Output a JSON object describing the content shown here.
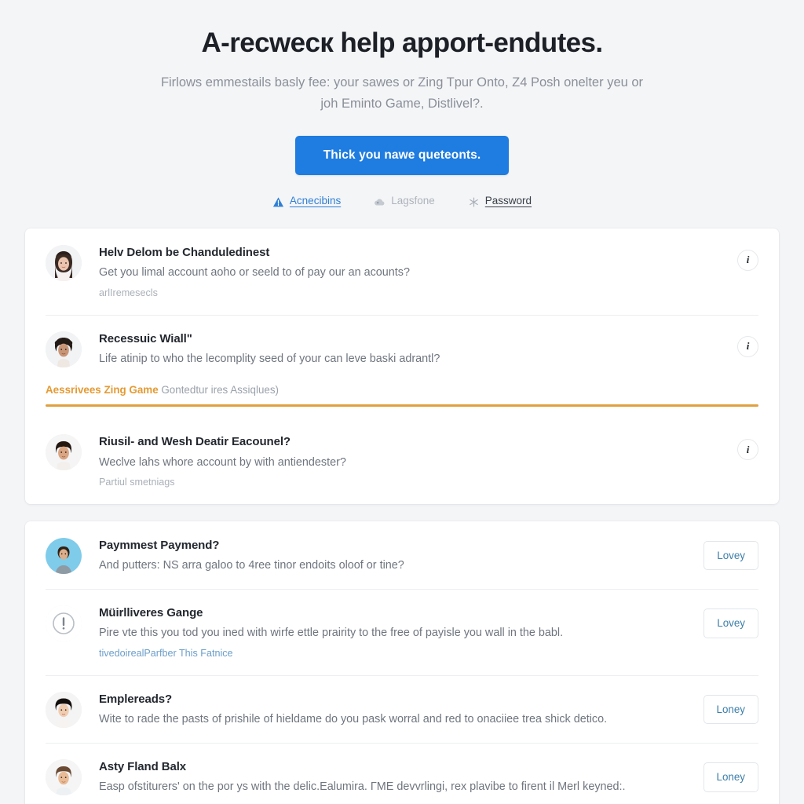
{
  "hero": {
    "title": "A-recwecк help apport-endutes.",
    "subtitle": "Firlows emmestails basly fee: your sawes or Zing Tpur Onto, Z4 Posh onelter yeu or joh Eminto Game, Distlivel?.",
    "cta_label": "Thick you nawe queteonts."
  },
  "tabs": [
    {
      "label": "Acnecibins",
      "icon": "warning-triangle-icon",
      "state": "accent"
    },
    {
      "label": "Lagsfone",
      "icon": "cloud-icon",
      "state": "muted"
    },
    {
      "label": "Password",
      "icon": "asterisk-icon",
      "state": "dark"
    }
  ],
  "card_one": {
    "rows": [
      {
        "title": "Helv Delom be Chanduledinest",
        "desc": "Get you limal account aoho or seeld to of pay our an acounts?",
        "meta": "arlIremesecls",
        "meta_style": "muted",
        "avatar": "woman-long-dark-hair",
        "action": {
          "type": "info",
          "glyph": "i",
          "name": "info-icon"
        }
      },
      {
        "title": "Recessuic Wiallʺ",
        "desc": "Life atinip to who the lecomplity seed of your can leve baski adrantl?",
        "meta": "",
        "meta_style": "none",
        "avatar": "woman-short-curly-hair",
        "action": {
          "type": "info",
          "glyph": "i",
          "name": "info-icon"
        }
      },
      {
        "title": "Riusil- and Wesh Deatir Eacounel?",
        "desc": "Weclve lahs whore account by with antiendester?",
        "meta": "Partiul smetniags",
        "meta_style": "muted",
        "avatar": "young-man-dark-hair",
        "action": {
          "type": "info",
          "glyph": "i",
          "name": "info-icon"
        }
      }
    ],
    "highlight": {
      "strong": "Aessrivees Zing Game",
      "rest": "Gontedtur ires Assiqlues)",
      "bar_color": "#e0a040"
    }
  },
  "card_two": {
    "rows": [
      {
        "title": "Paymmest Paymend?",
        "desc": "And putters: NS arra galoo to 4ree tinor endoits oloof or tine?",
        "meta": "",
        "meta_style": "none",
        "avatar": "man-blue-circle",
        "action": {
          "type": "button",
          "label": "Lovey",
          "name": "lovey-button"
        }
      },
      {
        "title": "Müirlliveres Gange",
        "desc": "Pire vte this you tod you ined with wirfe ettle prairity to the free of payisle you wall in the babl.",
        "meta": "tivedoirealParfber This Fatnice",
        "meta_style": "link",
        "avatar": "alert-circle-icon",
        "action": {
          "type": "button",
          "label": "Lovey",
          "name": "lovey-button"
        }
      },
      {
        "title": "Emplereads?",
        "desc": "Wite to rade the pasts of prishile of hieldame do you pask worral and red to onaciiee trea shick detico.",
        "meta": "",
        "meta_style": "none",
        "avatar": "woman-short-black-hair",
        "action": {
          "type": "button",
          "label": "Loney",
          "name": "loney-button"
        }
      },
      {
        "title": "Asty Fland Balx",
        "desc": "Easp ofstiturers' on the por ys with the delic.Ealumira. ΓME devvrlingi, rex plavibe to firent il Merl keyned:.",
        "meta": "",
        "meta_style": "none",
        "avatar": "man-light-shirt",
        "action": {
          "type": "button",
          "label": "Loney",
          "name": "loney-button"
        }
      }
    ]
  },
  "colors": {
    "page_background": "#f4f5f7",
    "card_background": "#ffffff",
    "cta_blue": "#1f7ce0",
    "accent_orange": "#e0a040",
    "link_blue": "#3c7ea8",
    "title_text": "#23272e",
    "body_text": "#6f757e"
  }
}
